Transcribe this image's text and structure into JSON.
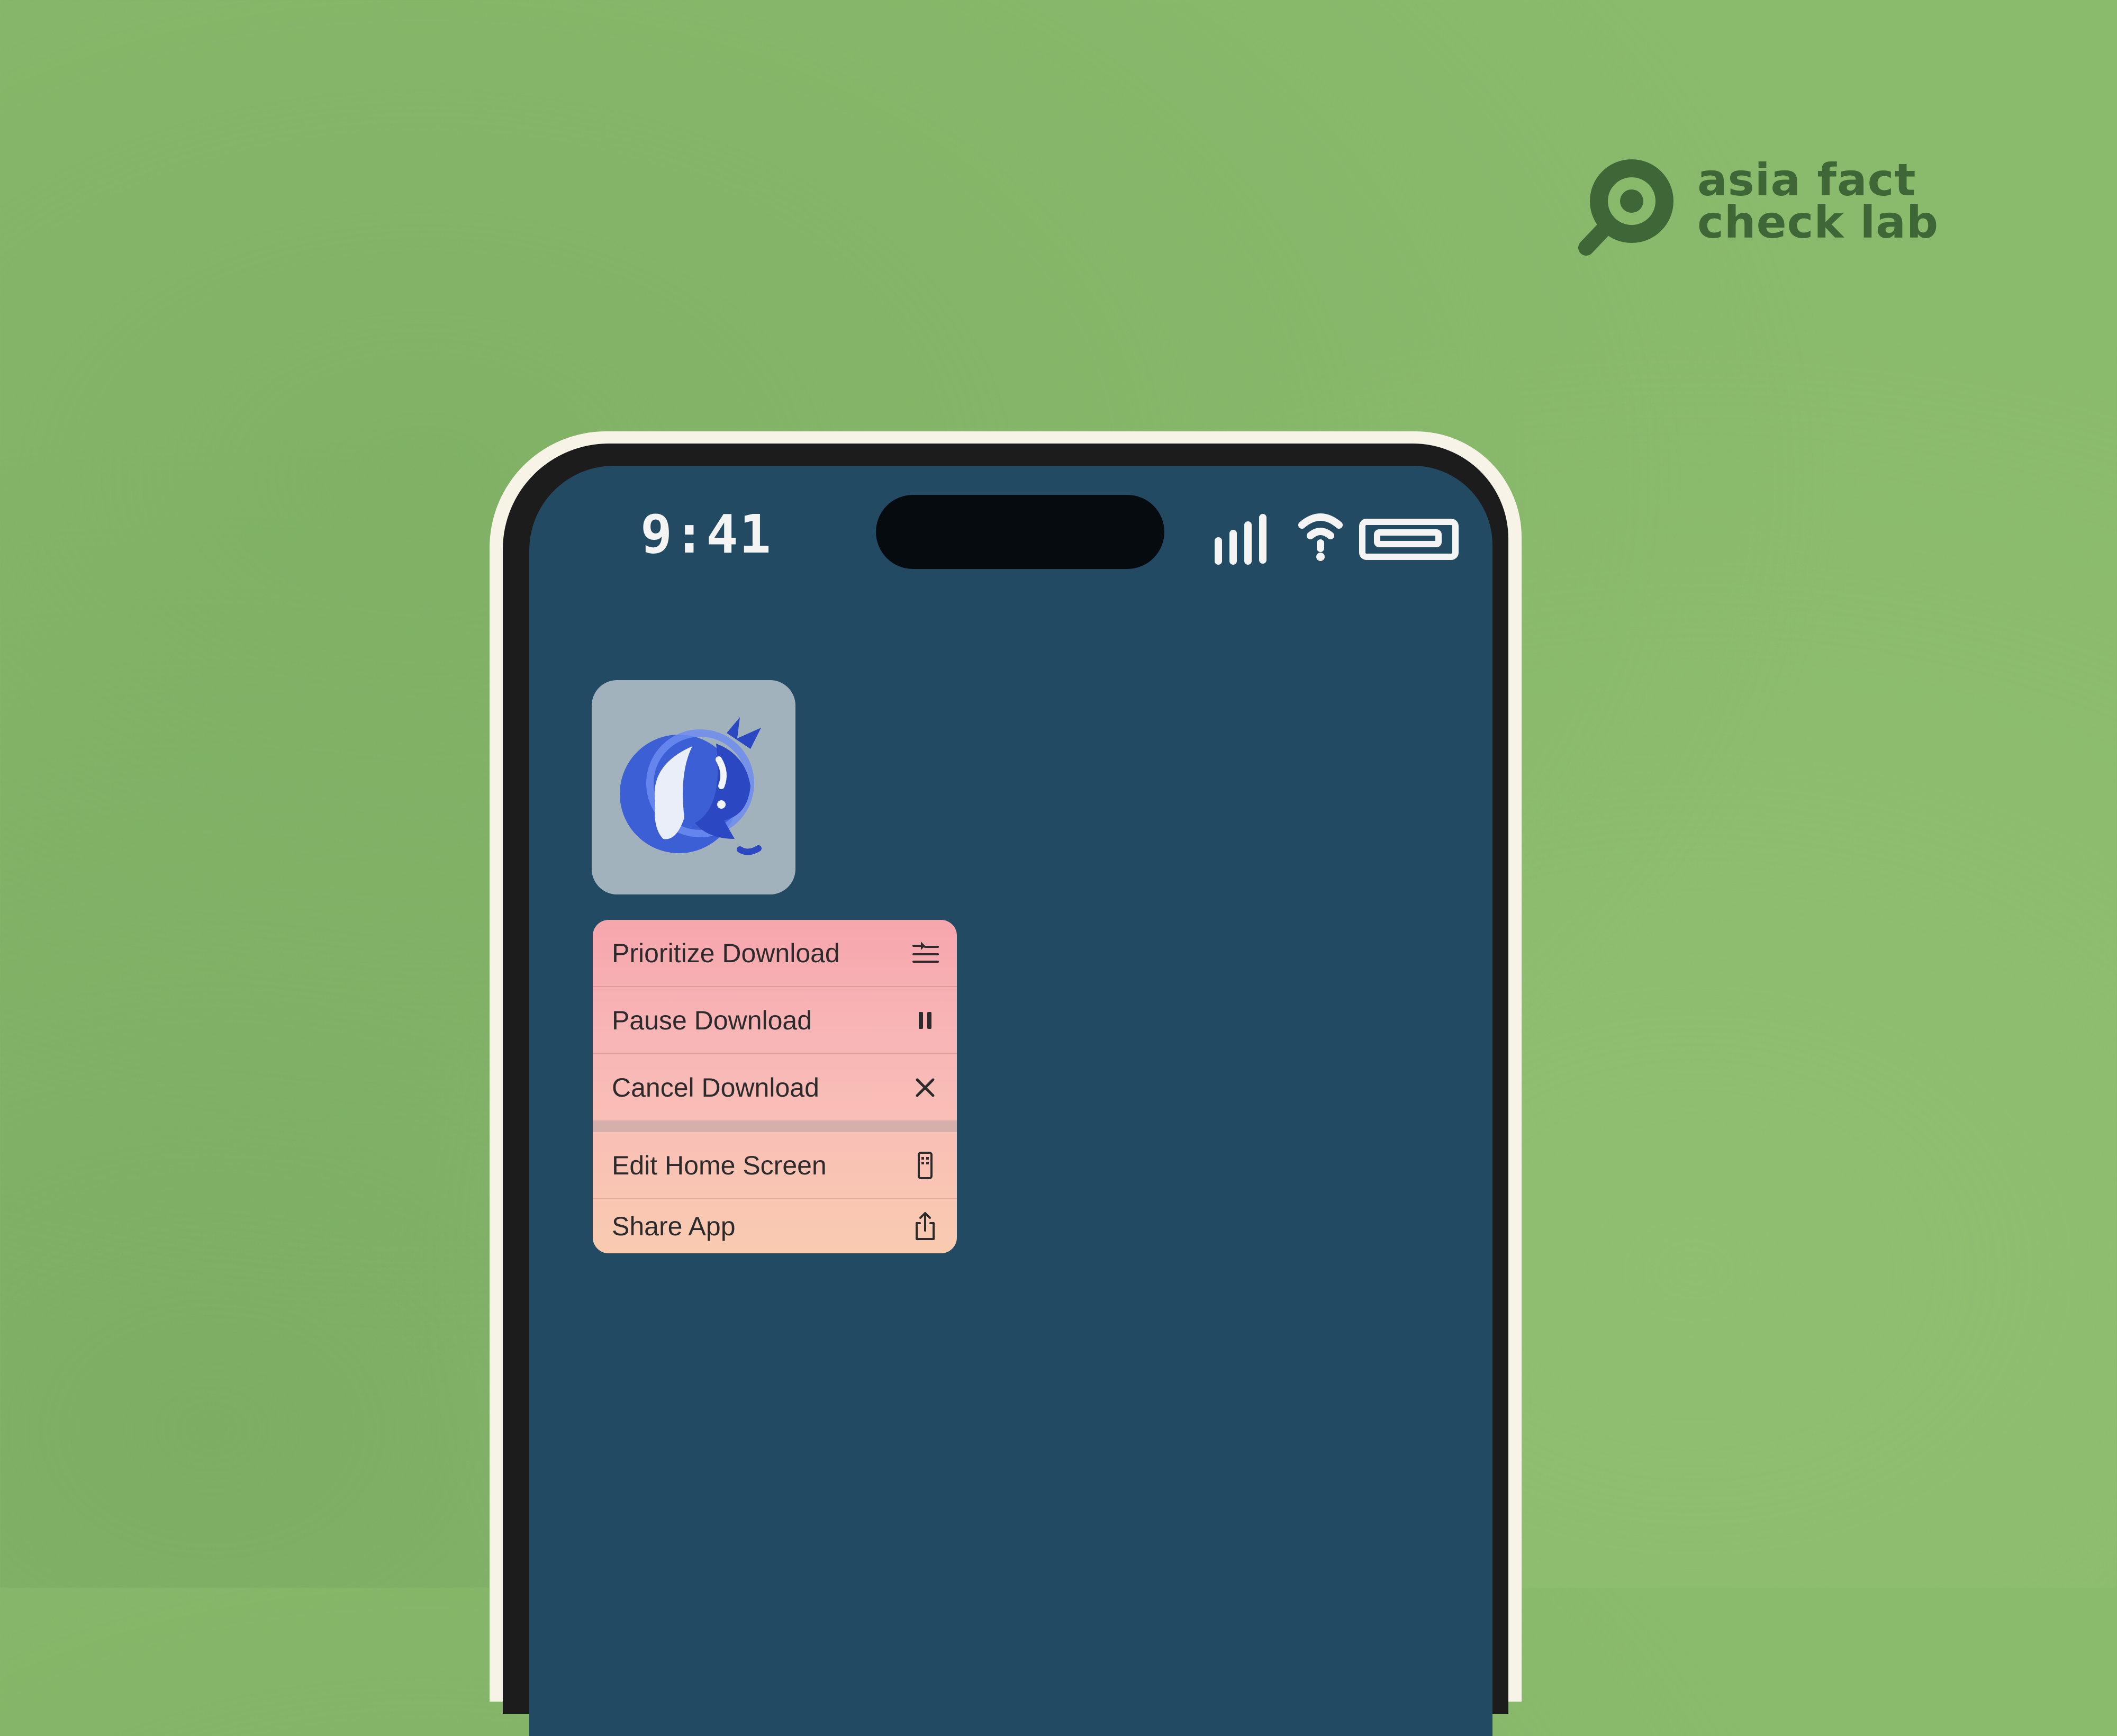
{
  "brand": {
    "name_line1": "asia fact",
    "name_line2": "check lab",
    "color": "#3f6636"
  },
  "status_bar": {
    "time": "9:41",
    "icons": [
      "cellular-signal-icon",
      "wifi-icon",
      "battery-icon"
    ]
  },
  "home_screen": {
    "app_icon": {
      "icon": "whale-app-icon",
      "color": "#4060d8"
    }
  },
  "context_menu": {
    "items": [
      {
        "label": "Prioritize Download",
        "icon": "prioritize-icon"
      },
      {
        "label": "Pause Download",
        "icon": "pause-icon"
      },
      {
        "label": "Cancel Download",
        "icon": "close-icon"
      },
      {
        "label": "Edit Home Screen",
        "icon": "phone-icon"
      },
      {
        "label": "Share App",
        "icon": "share-icon"
      }
    ]
  },
  "colors": {
    "background": "#8aba6c",
    "screen": "#224a62",
    "menu_top": "#f6a6ad",
    "menu_bottom": "#f9cbb0"
  }
}
